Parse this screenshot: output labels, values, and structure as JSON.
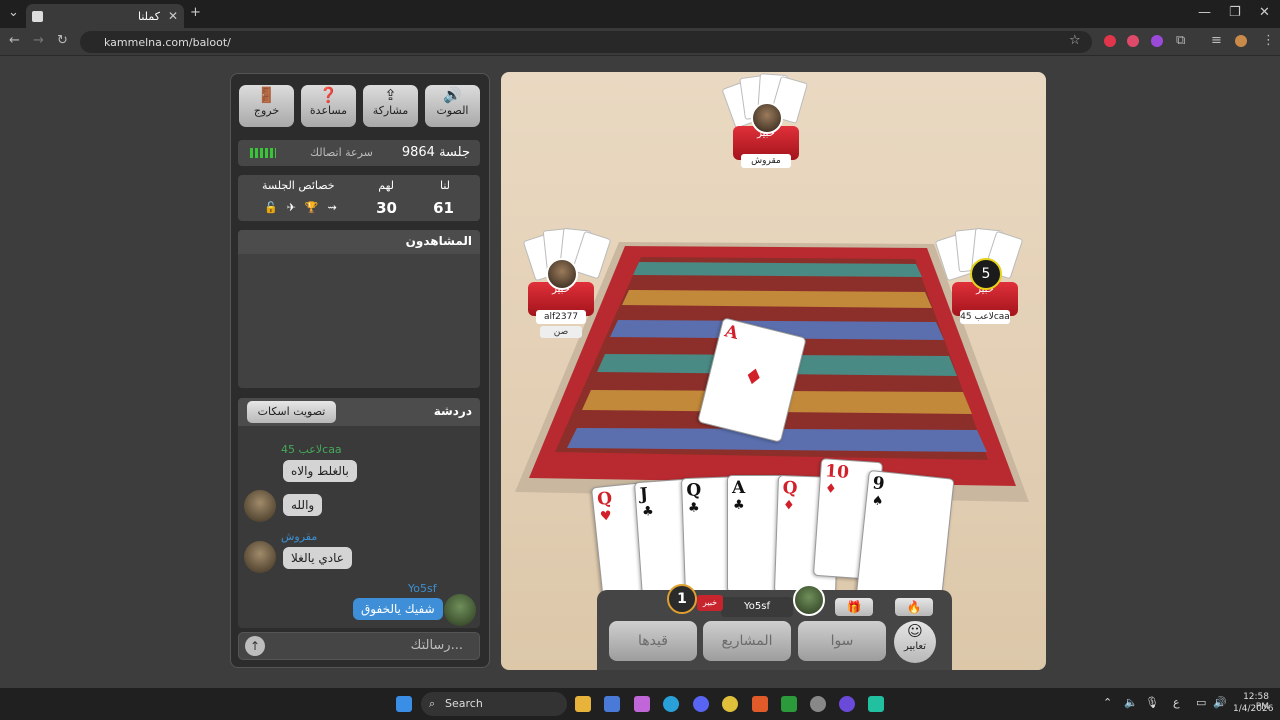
{
  "browser": {
    "tab_title": "كملنا",
    "url": "kammelna.com/baloot/"
  },
  "toolbar": {
    "buttons": [
      {
        "label": "الصوت",
        "icon": "speaker-icon"
      },
      {
        "label": "مشاركة",
        "icon": "share-icon"
      },
      {
        "label": "مساعدة",
        "icon": "help-icon"
      },
      {
        "label": "خروج",
        "icon": "exit-icon"
      }
    ]
  },
  "session": {
    "label": "جلسة 9864",
    "connection_label": "سرعة اتصالك"
  },
  "score": {
    "us_label": "لنا",
    "them_label": "لهم",
    "props_label": "خصائص الجلسة",
    "us": "61",
    "them": "30"
  },
  "spectators": {
    "title": "المشاهدون"
  },
  "chat": {
    "title": "دردشة",
    "mute_button": "تصويت اسكات",
    "messages": [
      {
        "name": "لاعب 45caa",
        "text": "بالغلط والاه"
      },
      {
        "name": "",
        "text": "والله"
      },
      {
        "name": "مقروش",
        "text": "عادي يالغلا"
      },
      {
        "name": "Yo5sf",
        "text": "شفيك يالخفوق"
      }
    ],
    "input_placeholder": "رسالتك..."
  },
  "game": {
    "top_player": {
      "title": "خبير",
      "name": "مقروش"
    },
    "left_player": {
      "title": "خبير",
      "name": "alf2377",
      "sub": "صن"
    },
    "right_player": {
      "title": "خبير",
      "name": "لاعب 45caa",
      "count": "5"
    },
    "played_card": {
      "rank": "A",
      "suit": "♦"
    },
    "hand": [
      {
        "rank": "Q",
        "suit": "♥",
        "color": "red"
      },
      {
        "rank": "J",
        "suit": "♣",
        "color": "black"
      },
      {
        "rank": "Q",
        "suit": "♣",
        "color": "black"
      },
      {
        "rank": "A",
        "suit": "♣",
        "color": "black"
      },
      {
        "rank": "Q",
        "suit": "♦",
        "color": "red"
      },
      {
        "rank": "10",
        "suit": "♦",
        "color": "red"
      },
      {
        "rank": "9",
        "suit": "♠",
        "color": "black"
      }
    ],
    "me": {
      "title": "خبير",
      "name": "Yo5sf",
      "badge": "1"
    },
    "buttons": {
      "expressions": "تعابير",
      "sawa": "سوا",
      "projects": "المشاريع",
      "record": "قيدها"
    }
  },
  "taskbar": {
    "search": "Search",
    "lang": "ع",
    "time": "12:58 PM",
    "date": "1/4/2026"
  }
}
